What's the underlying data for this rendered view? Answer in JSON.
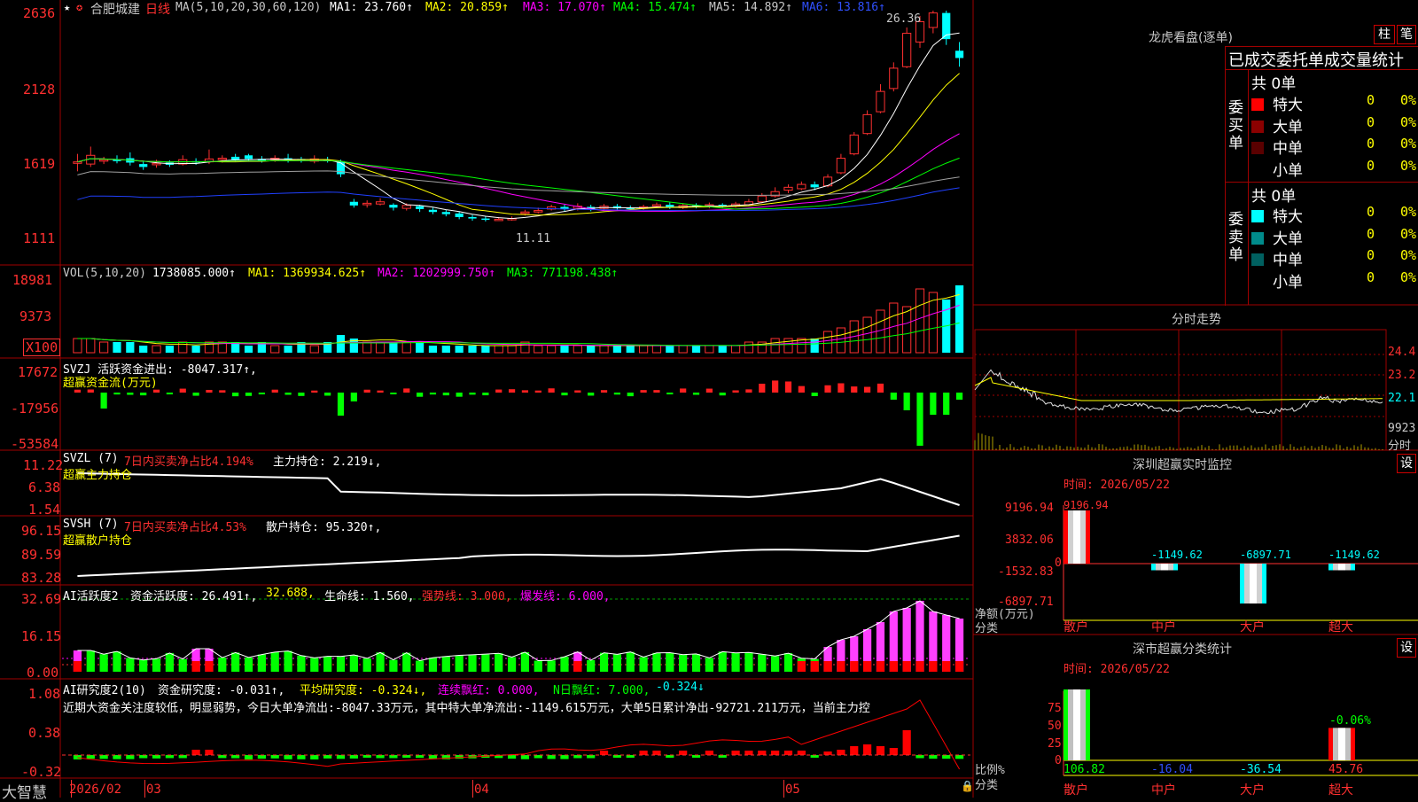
{
  "header": {
    "stock_name": "合肥城建",
    "period": "日线",
    "ma_label": "MA(5,10,20,30,60,120)",
    "ma1": "MA1: 23.760↑",
    "ma2": "MA2: 20.859↑",
    "ma3": "MA3: 17.070↑",
    "ma4": "MA4: 15.474↑",
    "ma5": "MA5: 14.892↑",
    "ma6": "MA6: 13.816↑",
    "high_mark": "26.36",
    "low_mark": "11.11"
  },
  "price_axis": [
    "2636",
    "2128",
    "1619",
    "1111"
  ],
  "vol": {
    "label": "VOL(5,10,20)",
    "value": "1738085.000↑",
    "ma1": "MA1: 1369934.625↑",
    "ma2": "MA2: 1202999.750↑",
    "ma3": "MA3: 771198.438↑",
    "axis": [
      "18981",
      "9373",
      "X100"
    ]
  },
  "svzj": {
    "label": "SVZJ  活跃资金进出: -8047.317↑,",
    "sub": "超赢资金流(万元)",
    "axis": [
      "17672",
      "-17956",
      "-53584"
    ]
  },
  "svzl": {
    "label": "SVZL  (7)",
    "pct": "7日内买卖净占比4.194%",
    "hold": "主力持仓: 2.219↓,",
    "sub": "超赢主力持仓",
    "axis": [
      "11.22",
      "6.38",
      "1.54"
    ]
  },
  "svsh": {
    "label": "SVSH  (7)",
    "pct": "7日内买卖净占比4.53%",
    "hold": "散户持仓: 95.320↑,",
    "sub": "超赢散户持仓",
    "axis": [
      "96.15",
      "89.59",
      "83.28"
    ]
  },
  "ai_act": {
    "label": "AI活跃度2",
    "v1": "资金活跃度: 26.491↑,",
    "v2": "32.688,",
    "v3": "生命线: 1.560,",
    "v4": "强势线: 3.000,",
    "v5": "爆发线: 6.000,",
    "axis": [
      "32.69",
      "16.15",
      "0.00"
    ]
  },
  "ai_res": {
    "label": "AI研究度2(10)",
    "v1": "资金研究度: -0.031↑,",
    "v2": "平均研究度: -0.324↓,",
    "v3": "连续飘红: 0.000,",
    "v4": "N日飘红: 7.000,",
    "v5": "-0.324↓",
    "comment": "近期大资金关注度较低，明显弱势，今日大单净流出:-8047.33万元，其中特大单净流出:-1149.615万元，大单5日累计净出-92721.211万元，当前主力控",
    "axis": [
      "1.08",
      "0.38",
      "-0.32"
    ]
  },
  "date_axis": {
    "brand": "大智慧",
    "labels": [
      "2026/02",
      "03",
      "04",
      "05"
    ]
  },
  "dragon": {
    "title": "龙虎看盘(逐单)",
    "btn1": "柱",
    "btn2": "笔",
    "subtitle": "已成交委托单成交量统计",
    "buy_total": "共 0单",
    "buy_side": "委买单",
    "sell_total": "共 0单",
    "sell_side": "委卖单",
    "buy_rows": [
      {
        "label": "特大",
        "num": "0",
        "pct": "0%",
        "color": "#ff0000"
      },
      {
        "label": "大单",
        "num": "0",
        "pct": "0%",
        "color": "#8b0000"
      },
      {
        "label": "中单",
        "num": "0",
        "pct": "0%",
        "color": "#5a0000"
      },
      {
        "label": "小单",
        "num": "0",
        "pct": "0%",
        "color": "#000000"
      }
    ],
    "sell_rows": [
      {
        "label": "特大",
        "num": "0",
        "pct": "0%",
        "color": "#00ffff"
      },
      {
        "label": "大单",
        "num": "0",
        "pct": "0%",
        "color": "#008b8b"
      },
      {
        "label": "中单",
        "num": "0",
        "pct": "0%",
        "color": "#006060"
      },
      {
        "label": "小单",
        "num": "0",
        "pct": "0%",
        "color": "#000000"
      }
    ]
  },
  "intraday": {
    "title": "分时走势",
    "axis": [
      "24.4",
      "23.2",
      "22.1",
      "9923",
      "分时"
    ]
  },
  "sz_monitor": {
    "title": "深圳超赢实时监控",
    "btn": "设",
    "time": "时间: 2026/05/22",
    "axis": [
      "9196.94",
      "3832.06",
      "0",
      "-1532.83",
      "-6897.71"
    ],
    "ylabel1": "净额(万元)",
    "ylabel2": "分类",
    "bars": [
      {
        "cat": "散户",
        "value": 9196.94,
        "label": "9196.94"
      },
      {
        "cat": "中户",
        "value": -1149.62,
        "label": "-1149.62"
      },
      {
        "cat": "大户",
        "value": -6897.71,
        "label": "-6897.71"
      },
      {
        "cat": "超大",
        "value": -1149.62,
        "label": "-1149.62"
      }
    ]
  },
  "sz_stats": {
    "title": "深市超赢分类统计",
    "btn": "设",
    "time": "时间: 2026/05/22",
    "axis": [
      "75",
      "50",
      "25",
      "0"
    ],
    "ylabel1": "比例%",
    "ylabel2": "分类",
    "bars": [
      {
        "cat": "散户",
        "value": 106.82,
        "label": "106.82"
      },
      {
        "cat": "中户",
        "value": -16.04,
        "label": "-16.04"
      },
      {
        "cat": "大户",
        "value": -36.54,
        "label": "-36.54"
      },
      {
        "cat": "超大",
        "value": 45.76,
        "label": "45.76"
      }
    ],
    "top_label": "-0.06%"
  },
  "chart_data": {
    "type": "candlestick",
    "title": "合肥城建 日线",
    "ylim": [
      1111,
      2636
    ],
    "x_labels": [
      "2026/02",
      "03",
      "04",
      "05"
    ],
    "candles": [
      {
        "o": 1585,
        "c": 1595,
        "h": 1650,
        "l": 1530
      },
      {
        "o": 1580,
        "c": 1640,
        "h": 1700,
        "l": 1560
      },
      {
        "o": 1600,
        "c": 1610,
        "h": 1630,
        "l": 1580
      },
      {
        "o": 1610,
        "c": 1600,
        "h": 1640,
        "l": 1585
      },
      {
        "o": 1620,
        "c": 1590,
        "h": 1660,
        "l": 1570
      },
      {
        "o": 1580,
        "c": 1560,
        "h": 1600,
        "l": 1540
      },
      {
        "o": 1575,
        "c": 1585,
        "h": 1610,
        "l": 1555
      },
      {
        "o": 1590,
        "c": 1575,
        "h": 1605,
        "l": 1560
      },
      {
        "o": 1580,
        "c": 1610,
        "h": 1640,
        "l": 1570
      },
      {
        "o": 1600,
        "c": 1590,
        "h": 1620,
        "l": 1575
      },
      {
        "o": 1595,
        "c": 1615,
        "h": 1680,
        "l": 1580
      },
      {
        "o": 1610,
        "c": 1620,
        "h": 1640,
        "l": 1590
      },
      {
        "o": 1630,
        "c": 1610,
        "h": 1650,
        "l": 1595
      },
      {
        "o": 1640,
        "c": 1615,
        "h": 1650,
        "l": 1600
      },
      {
        "o": 1615,
        "c": 1605,
        "h": 1635,
        "l": 1590
      },
      {
        "o": 1610,
        "c": 1620,
        "h": 1640,
        "l": 1595
      },
      {
        "o": 1620,
        "c": 1610,
        "h": 1650,
        "l": 1590
      },
      {
        "o": 1615,
        "c": 1605,
        "h": 1630,
        "l": 1590
      },
      {
        "o": 1600,
        "c": 1615,
        "h": 1640,
        "l": 1585
      },
      {
        "o": 1610,
        "c": 1600,
        "h": 1630,
        "l": 1590
      },
      {
        "o": 1600,
        "c": 1510,
        "h": 1610,
        "l": 1490
      },
      {
        "o": 1320,
        "c": 1295,
        "h": 1340,
        "l": 1280
      },
      {
        "o": 1300,
        "c": 1310,
        "h": 1330,
        "l": 1280
      },
      {
        "o": 1305,
        "c": 1320,
        "h": 1345,
        "l": 1295
      },
      {
        "o": 1300,
        "c": 1280,
        "h": 1310,
        "l": 1260
      },
      {
        "o": 1275,
        "c": 1295,
        "h": 1310,
        "l": 1260
      },
      {
        "o": 1290,
        "c": 1270,
        "h": 1300,
        "l": 1250
      },
      {
        "o": 1265,
        "c": 1250,
        "h": 1280,
        "l": 1235
      },
      {
        "o": 1250,
        "c": 1235,
        "h": 1265,
        "l": 1220
      },
      {
        "o": 1240,
        "c": 1215,
        "h": 1255,
        "l": 1200
      },
      {
        "o": 1215,
        "c": 1205,
        "h": 1230,
        "l": 1190
      },
      {
        "o": 1205,
        "c": 1200,
        "h": 1220,
        "l": 1185
      },
      {
        "o": 1200,
        "c": 1200,
        "h": 1215,
        "l": 1190
      },
      {
        "o": 1200,
        "c": 1205,
        "h": 1220,
        "l": 1190
      },
      {
        "o": 1240,
        "c": 1250,
        "h": 1265,
        "l": 1225
      },
      {
        "o": 1250,
        "c": 1260,
        "h": 1280,
        "l": 1240
      },
      {
        "o": 1270,
        "c": 1285,
        "h": 1300,
        "l": 1260
      },
      {
        "o": 1285,
        "c": 1270,
        "h": 1300,
        "l": 1255
      },
      {
        "o": 1275,
        "c": 1290,
        "h": 1310,
        "l": 1260
      },
      {
        "o": 1285,
        "c": 1270,
        "h": 1300,
        "l": 1255
      },
      {
        "o": 1275,
        "c": 1290,
        "h": 1305,
        "l": 1265
      },
      {
        "o": 1290,
        "c": 1275,
        "h": 1305,
        "l": 1260
      },
      {
        "o": 1280,
        "c": 1270,
        "h": 1295,
        "l": 1260
      },
      {
        "o": 1275,
        "c": 1285,
        "h": 1300,
        "l": 1265
      },
      {
        "o": 1290,
        "c": 1300,
        "h": 1315,
        "l": 1280
      },
      {
        "o": 1300,
        "c": 1280,
        "h": 1315,
        "l": 1270
      },
      {
        "o": 1280,
        "c": 1295,
        "h": 1310,
        "l": 1270
      },
      {
        "o": 1295,
        "c": 1285,
        "h": 1310,
        "l": 1275
      },
      {
        "o": 1285,
        "c": 1300,
        "h": 1315,
        "l": 1275
      },
      {
        "o": 1300,
        "c": 1290,
        "h": 1310,
        "l": 1280
      },
      {
        "o": 1290,
        "c": 1305,
        "h": 1320,
        "l": 1280
      },
      {
        "o": 1300,
        "c": 1320,
        "h": 1340,
        "l": 1290
      },
      {
        "o": 1320,
        "c": 1360,
        "h": 1380,
        "l": 1310
      },
      {
        "o": 1360,
        "c": 1390,
        "h": 1420,
        "l": 1350
      },
      {
        "o": 1400,
        "c": 1420,
        "h": 1440,
        "l": 1380
      },
      {
        "o": 1410,
        "c": 1440,
        "h": 1460,
        "l": 1400
      },
      {
        "o": 1440,
        "c": 1420,
        "h": 1460,
        "l": 1400
      },
      {
        "o": 1430,
        "c": 1490,
        "h": 1510,
        "l": 1420
      },
      {
        "o": 1520,
        "c": 1620,
        "h": 1650,
        "l": 1510
      },
      {
        "o": 1650,
        "c": 1780,
        "h": 1800,
        "l": 1640
      },
      {
        "o": 1790,
        "c": 1920,
        "h": 1950,
        "l": 1780
      },
      {
        "o": 1940,
        "c": 2080,
        "h": 2130,
        "l": 1930
      },
      {
        "o": 2100,
        "c": 2240,
        "h": 2280,
        "l": 2080
      },
      {
        "o": 2250,
        "c": 2480,
        "h": 2520,
        "l": 2240
      },
      {
        "o": 2420,
        "c": 2560,
        "h": 2600,
        "l": 2380
      },
      {
        "o": 2520,
        "c": 2620,
        "h": 2636,
        "l": 2480
      },
      {
        "o": 2620,
        "c": 2440,
        "h": 2636,
        "l": 2400
      },
      {
        "o": 2360,
        "c": 2310,
        "h": 2420,
        "l": 2250
      }
    ],
    "volume": [
      4,
      4,
      3,
      3,
      3,
      2,
      2,
      2,
      3,
      2,
      3,
      3,
      3,
      2,
      3,
      2,
      2,
      3,
      2,
      3,
      5,
      4,
      3,
      3,
      3,
      3,
      3,
      2,
      2,
      2,
      2,
      2,
      2,
      2,
      3,
      2,
      2,
      2,
      2,
      2,
      2,
      2,
      2,
      2,
      2,
      2,
      2,
      2,
      2,
      2,
      2,
      3,
      3,
      4,
      4,
      4,
      4,
      6,
      7,
      9,
      10,
      12,
      14,
      13,
      18,
      17,
      15,
      19
    ]
  }
}
